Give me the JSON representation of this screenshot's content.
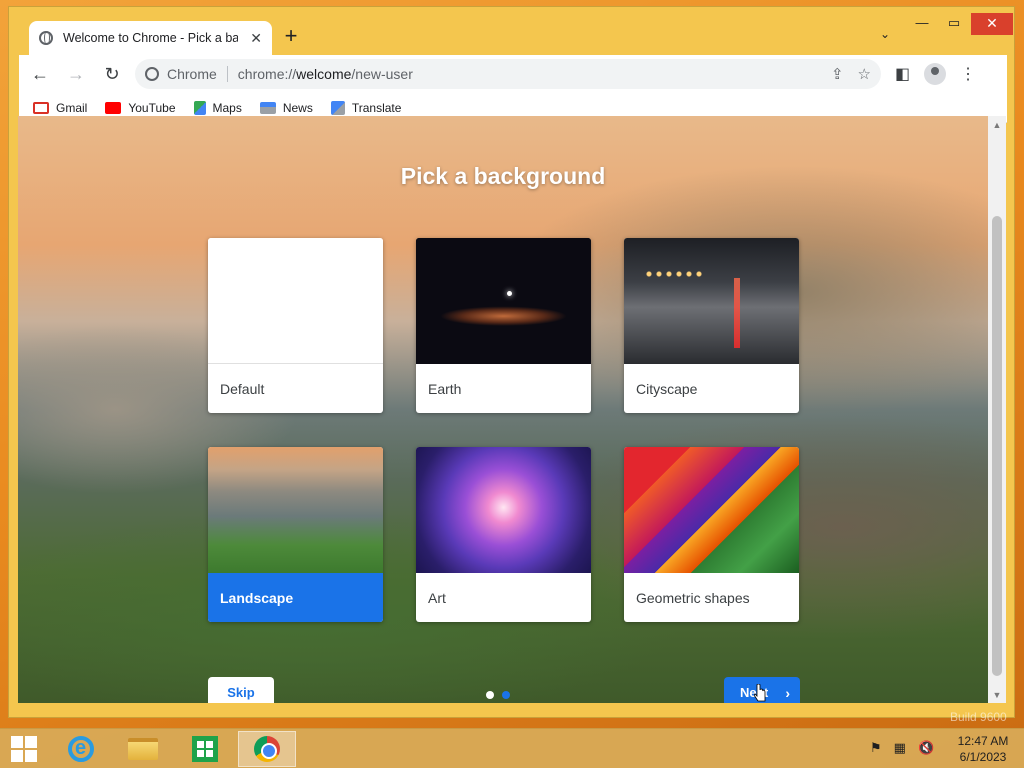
{
  "browser": {
    "tab_title": "Welcome to Chrome - Pick a bac",
    "tab_close": "✕",
    "new_tab": "+",
    "tab_search": "⌄",
    "window_controls": {
      "minimize": "—",
      "maximize": "▭",
      "close": "✕"
    },
    "back": "←",
    "forward": "→",
    "reload": "↻",
    "omnibox_chip": "Chrome",
    "url_prefix": "chrome://",
    "url_host": "welcome",
    "url_path": "/new-user",
    "share_icon": "⇪",
    "bookmark_icon": "☆",
    "sidepanel_icon": "◧",
    "menu_icon": "⋮"
  },
  "bookmarks": [
    {
      "label": "Gmail",
      "icon": "gmail-icon",
      "color": "#d93025"
    },
    {
      "label": "YouTube",
      "icon": "youtube-icon",
      "color": "#ff0000"
    },
    {
      "label": "Maps",
      "icon": "maps-icon",
      "color": "#34a853"
    },
    {
      "label": "News",
      "icon": "news-icon",
      "color": "#4285f4"
    },
    {
      "label": "Translate",
      "icon": "translate-icon",
      "color": "#4285f4"
    }
  ],
  "page": {
    "title": "Pick a background",
    "backgrounds": [
      {
        "label": "Default",
        "selected": false
      },
      {
        "label": "Earth",
        "selected": false
      },
      {
        "label": "Cityscape",
        "selected": false
      },
      {
        "label": "Landscape",
        "selected": true
      },
      {
        "label": "Art",
        "selected": false
      },
      {
        "label": "Geometric shapes",
        "selected": false
      }
    ],
    "skip": "Skip",
    "next": "Next",
    "next_chevron": "›",
    "pager": {
      "total": 2,
      "current": 2
    }
  },
  "taskbar": {
    "time": "12:47 AM",
    "date": "6/1/2023",
    "watermark": "Build 9600",
    "tray_icons": [
      "flag-icon",
      "network-icon",
      "volume-muted-icon"
    ]
  },
  "colors": {
    "accent": "#1a73e8",
    "close_button": "#d9402c"
  }
}
